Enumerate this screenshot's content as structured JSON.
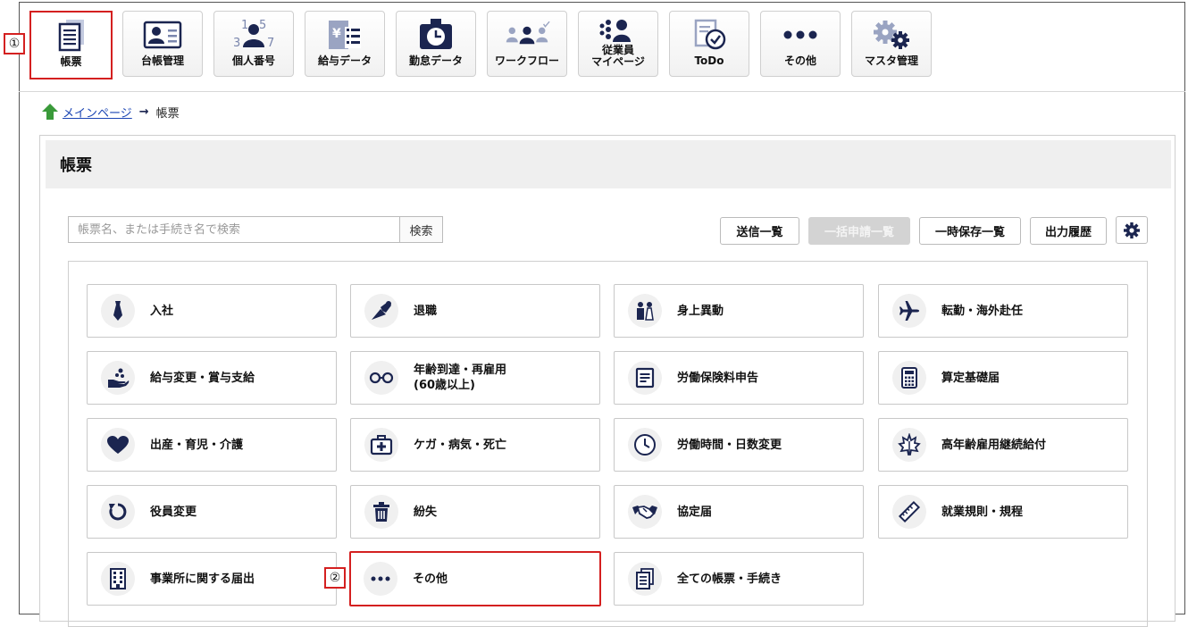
{
  "markers": {
    "m1": "①",
    "m2": "②"
  },
  "nav": [
    {
      "label": "帳票",
      "icon": "document-icon"
    },
    {
      "label": "台帳管理",
      "icon": "id-card-icon"
    },
    {
      "label": "個人番号",
      "icon": "person-number-icon"
    },
    {
      "label": "給与データ",
      "icon": "payroll-icon"
    },
    {
      "label": "勤怠データ",
      "icon": "timecard-icon"
    },
    {
      "label": "ワークフロー",
      "icon": "people-group-icon"
    },
    {
      "label": "従業員\nマイページ",
      "icon": "employee-icon"
    },
    {
      "label": "ToDo",
      "icon": "todo-icon"
    },
    {
      "label": "その他",
      "icon": "more-icon"
    },
    {
      "label": "マスタ管理",
      "icon": "gears-icon"
    }
  ],
  "breadcrumb": {
    "home": "メインページ",
    "current": "帳票"
  },
  "panel": {
    "title": "帳票"
  },
  "search": {
    "placeholder": "帳票名、または手続き名で検索",
    "button": "検索"
  },
  "toolbar": {
    "send_list": "送信一覧",
    "bulk_list": "一括申請一覧",
    "saved_list": "一時保存一覧",
    "output_history": "出力履歴"
  },
  "cards": [
    {
      "label": "入社",
      "icon": "necktie-icon"
    },
    {
      "label": "退職",
      "icon": "bouquet-icon"
    },
    {
      "label": "身上異動",
      "icon": "couple-icon"
    },
    {
      "label": "転勤・海外赴任",
      "icon": "airplane-icon"
    },
    {
      "label": "給与変更・賞与支給",
      "icon": "hand-coins-icon"
    },
    {
      "label": "年齢到達・再雇用\n(60歳以上)",
      "icon": "glasses-icon"
    },
    {
      "label": "労働保険料申告",
      "icon": "form-icon"
    },
    {
      "label": "算定基礎届",
      "icon": "calculator-icon"
    },
    {
      "label": "出産・育児・介護",
      "icon": "heart-icon"
    },
    {
      "label": "ケガ・病気・死亡",
      "icon": "first-aid-icon"
    },
    {
      "label": "労働時間・日数変更",
      "icon": "clock-icon"
    },
    {
      "label": "高年齢雇用継続給付",
      "icon": "maple-leaf-icon"
    },
    {
      "label": "役員変更",
      "icon": "refresh-icon"
    },
    {
      "label": "紛失",
      "icon": "trash-icon"
    },
    {
      "label": "協定届",
      "icon": "handshake-icon"
    },
    {
      "label": "就業規則・規程",
      "icon": "ruler-icon"
    },
    {
      "label": "事業所に関する届出",
      "icon": "building-icon"
    },
    {
      "label": "その他",
      "icon": "more-icon"
    },
    {
      "label": "全ての帳票・手続き",
      "icon": "documents-icon"
    }
  ]
}
